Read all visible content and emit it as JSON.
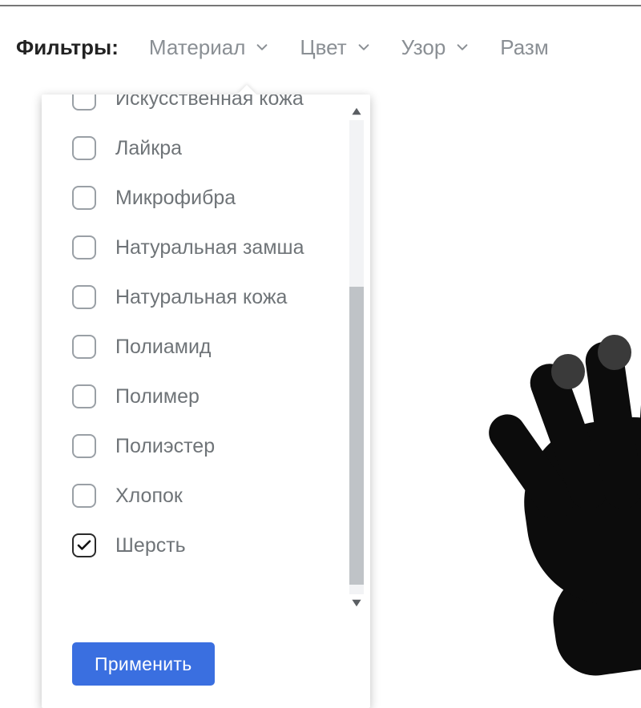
{
  "filters_label": "Фильтры:",
  "filter_chips": [
    {
      "label": "Материал"
    },
    {
      "label": "Цвет"
    },
    {
      "label": "Узор"
    },
    {
      "label": "Разм"
    }
  ],
  "material_options": [
    {
      "label": "Искусственная кожа",
      "checked": false
    },
    {
      "label": "Лайкра",
      "checked": false
    },
    {
      "label": "Микрофибра",
      "checked": false
    },
    {
      "label": "Натуральная замша",
      "checked": false
    },
    {
      "label": "Натуральная кожа",
      "checked": false
    },
    {
      "label": "Полиамид",
      "checked": false
    },
    {
      "label": "Полимер",
      "checked": false
    },
    {
      "label": "Полиэстер",
      "checked": false
    },
    {
      "label": "Хлопок",
      "checked": false
    },
    {
      "label": "Шерсть",
      "checked": true
    }
  ],
  "apply_label": "Применить"
}
